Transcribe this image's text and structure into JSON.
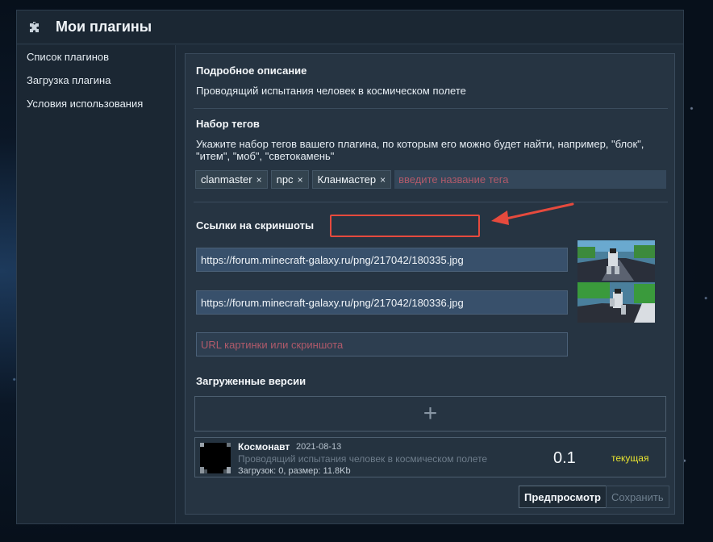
{
  "app": {
    "title": "Мои плагины",
    "icon": "puzzle-icon"
  },
  "sidebar": {
    "items": [
      {
        "label": "Список плагинов"
      },
      {
        "label": "Загрузка плагина"
      },
      {
        "label": "Условия использования"
      }
    ]
  },
  "description": {
    "title": "Подробное описание",
    "text": "Проводящий испытания человек в космическом полете"
  },
  "tags": {
    "title": "Набор тегов",
    "hint": "Укажите набор тегов вашего плагина, по которым его можно будет найти, например, \"блок\", \"итем\", \"моб\", \"светокамень\"",
    "items": [
      {
        "label": "clanmaster"
      },
      {
        "label": "npc"
      },
      {
        "label": "Кланмастер"
      }
    ],
    "remove_glyph": "×",
    "input_placeholder": "введите название тега"
  },
  "screenshots": {
    "title": "Ссылки на скриншоты",
    "links": [
      {
        "value": "https://forum.minecraft-galaxy.ru/png/217042/180335.jpg"
      },
      {
        "value": "https://forum.minecraft-galaxy.ru/png/217042/180336.jpg"
      }
    ],
    "new_placeholder": "URL картинки или скриншота"
  },
  "versions": {
    "title": "Загруженные версии",
    "add_glyph": "+",
    "items": [
      {
        "name": "Космонавт",
        "date": "2021-08-13",
        "description": "Проводящий испытания человек в космическом полете",
        "meta": "Загрузок: 0, размер: 11.8Kb",
        "version": "0.1",
        "status": "текущая"
      }
    ]
  },
  "actions": {
    "preview_label": "Предпросмотр",
    "save_label": "Сохранить"
  },
  "colors": {
    "accent_annotation": "#e64a3d",
    "status_current": "#e7e230"
  }
}
